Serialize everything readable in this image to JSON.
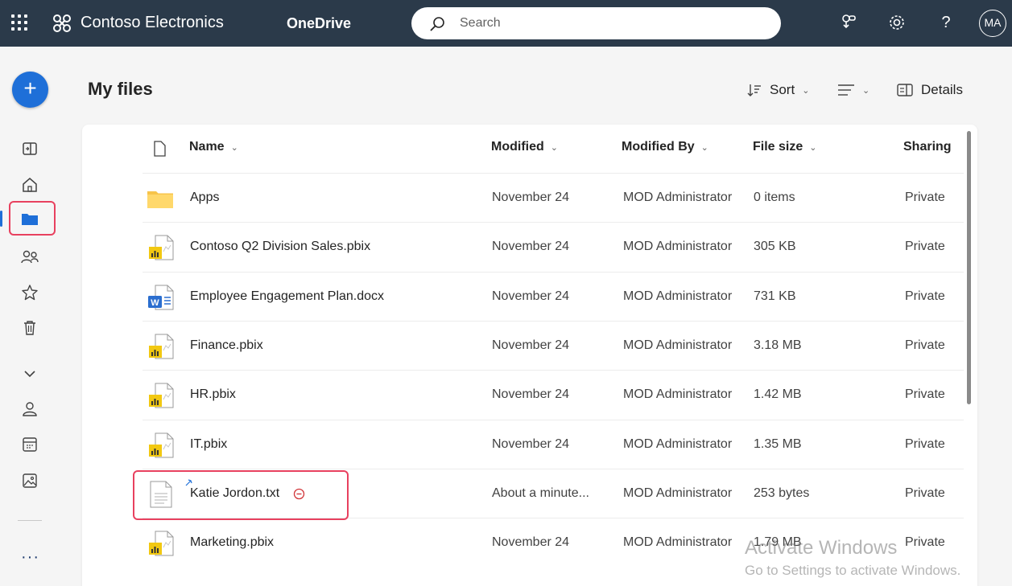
{
  "topbar": {
    "org_name": "Contoso Electronics",
    "app_name": "OneDrive",
    "search_placeholder": "Search",
    "avatar_initials": "MA"
  },
  "page": {
    "title": "My files"
  },
  "commands": {
    "sort": "Sort",
    "details": "Details"
  },
  "columns": {
    "name": "Name",
    "modified": "Modified",
    "modified_by": "Modified By",
    "file_size": "File size",
    "sharing": "Sharing"
  },
  "files": [
    {
      "name": "Apps",
      "type": "folder",
      "modified": "November 24",
      "modified_by": "MOD Administrator",
      "size": "0 items",
      "sharing": "Private"
    },
    {
      "name": "Contoso Q2 Division Sales.pbix",
      "type": "pbix",
      "modified": "November 24",
      "modified_by": "MOD Administrator",
      "size": "305 KB",
      "sharing": "Private"
    },
    {
      "name": "Employee Engagement Plan.docx",
      "type": "docx",
      "modified": "November 24",
      "modified_by": "MOD Administrator",
      "size": "731 KB",
      "sharing": "Private"
    },
    {
      "name": "Finance.pbix",
      "type": "pbix",
      "modified": "November 24",
      "modified_by": "MOD Administrator",
      "size": "3.18 MB",
      "sharing": "Private"
    },
    {
      "name": "HR.pbix",
      "type": "pbix",
      "modified": "November 24",
      "modified_by": "MOD Administrator",
      "size": "1.42 MB",
      "sharing": "Private"
    },
    {
      "name": "IT.pbix",
      "type": "pbix",
      "modified": "November 24",
      "modified_by": "MOD Administrator",
      "size": "1.35 MB",
      "sharing": "Private"
    },
    {
      "name": "Katie Jordon.txt",
      "type": "txt",
      "modified": "About a minute...",
      "modified_by": "MOD Administrator",
      "size": "253 bytes",
      "sharing": "Private"
    },
    {
      "name": "Marketing.pbix",
      "type": "pbix",
      "modified": "November 24",
      "modified_by": "MOD Administrator",
      "size": "1.79 MB",
      "sharing": "Private"
    }
  ],
  "watermark": {
    "line1": "Activate Windows",
    "line2": "Go to Settings to activate Windows."
  },
  "icons": {
    "rail": [
      "collapse-pane-icon",
      "home-icon",
      "folder-icon",
      "people-icon",
      "star-icon",
      "trash-icon",
      "chevron-down-icon",
      "person-icon",
      "calendar-icon",
      "image-icon"
    ],
    "topbar": [
      "app-launcher-icon",
      "share-icon",
      "gear-icon",
      "help-icon"
    ]
  },
  "colors": {
    "topbar": "#2b3a4a",
    "accent": "#1e6fd8",
    "highlight": "#e8415f",
    "folder": "#f7c44a",
    "powerbi": "#f2c811",
    "word": "#2b6ecf"
  }
}
